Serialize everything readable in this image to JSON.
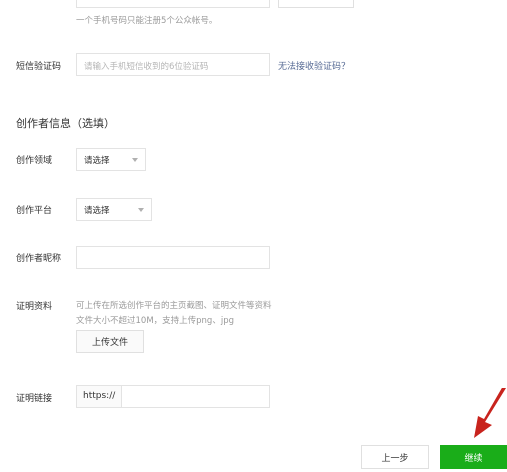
{
  "phone": {
    "hint": "一个手机号码只能注册5个公众帐号。"
  },
  "sms": {
    "label": "短信验证码",
    "placeholder": "请输入手机短信收到的6位验证码",
    "help_link": "无法接收验证码？"
  },
  "creator_section": {
    "title": "创作者信息（选填）"
  },
  "field_domain": {
    "label": "创作领域",
    "value": "请选择"
  },
  "field_platform": {
    "label": "创作平台",
    "value": "请选择"
  },
  "field_nickname": {
    "label": "创作者昵称",
    "value": ""
  },
  "proof_material": {
    "label": "证明资料",
    "desc_line1": "可上传在所选创作平台的主页截图、证明文件等资料",
    "desc_line2": "文件大小不超过10M，支持上传png、jpg",
    "upload_label": "上传文件"
  },
  "proof_link": {
    "label": "证明链接",
    "prefix": "https://",
    "value": ""
  },
  "footer": {
    "prev_label": "上一步",
    "next_label": "继续"
  },
  "colors": {
    "primary": "#1aad19",
    "link": "#576b95",
    "arrow": "#c8231d"
  }
}
